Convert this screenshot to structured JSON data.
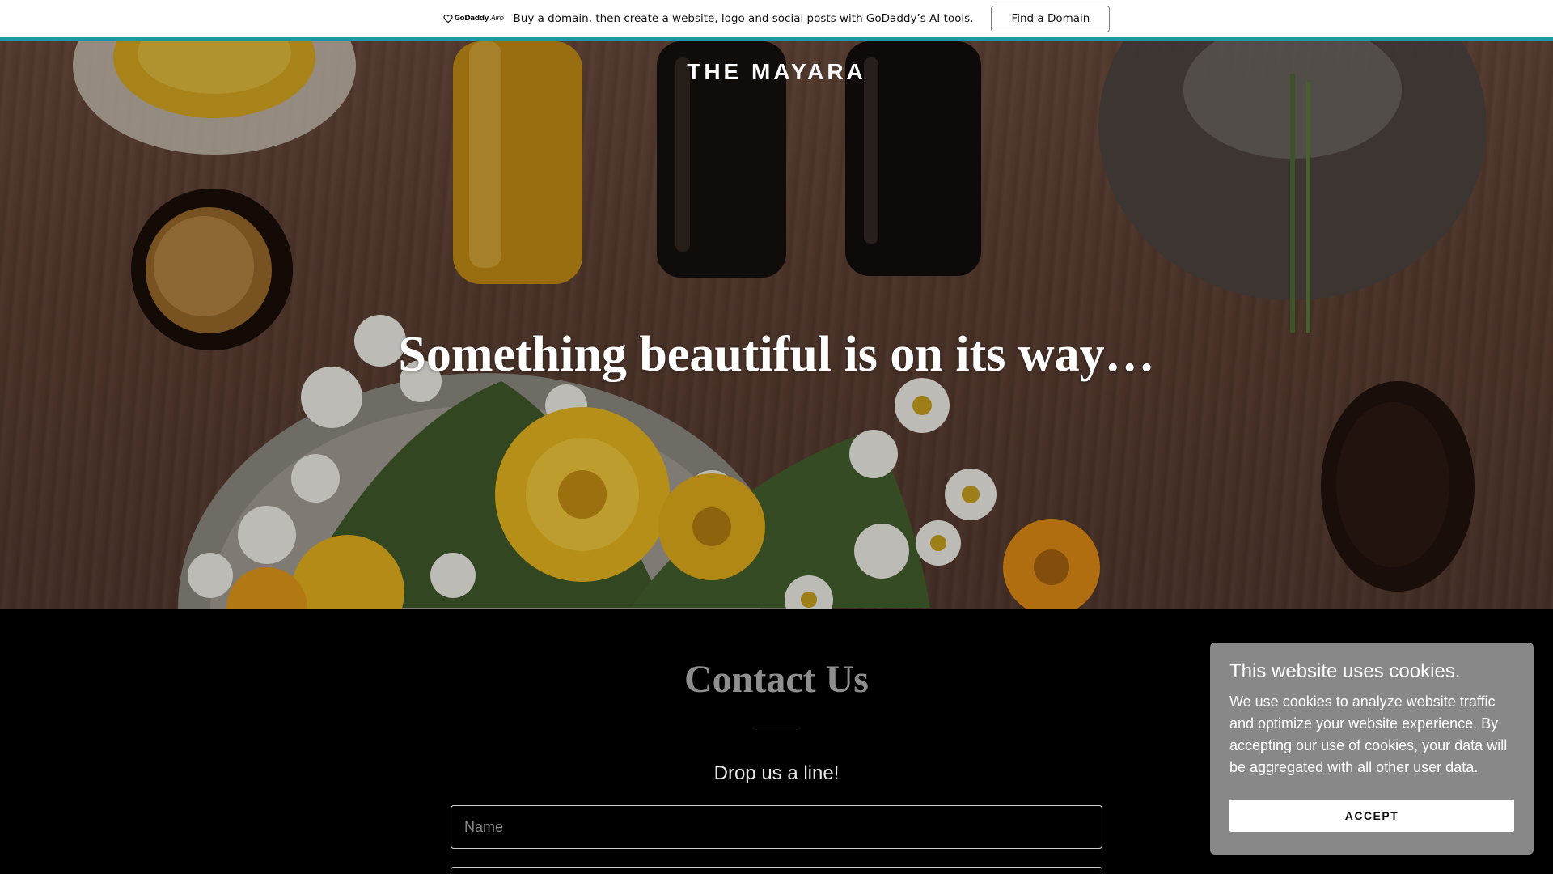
{
  "promo": {
    "logo_text": "GoDaddy",
    "logo_suffix": "Airo",
    "message": "Buy a domain, then create a website, logo and social posts with GoDaddy’s AI tools.",
    "button_label": "Find a Domain",
    "accent_color": "#1d9aa0"
  },
  "hero": {
    "brand": "THE MAYARA",
    "headline": "Something beautiful is on its way…"
  },
  "contact": {
    "title": "Contact Us",
    "subtitle": "Drop us a line!",
    "name_placeholder": "Name"
  },
  "cookie": {
    "title": "This website uses cookies.",
    "body": "We use cookies to analyze website traffic and optimize your website experience. By accepting our use of cookies, your data will be aggregated with all other user data.",
    "accept_label": "ACCEPT"
  }
}
